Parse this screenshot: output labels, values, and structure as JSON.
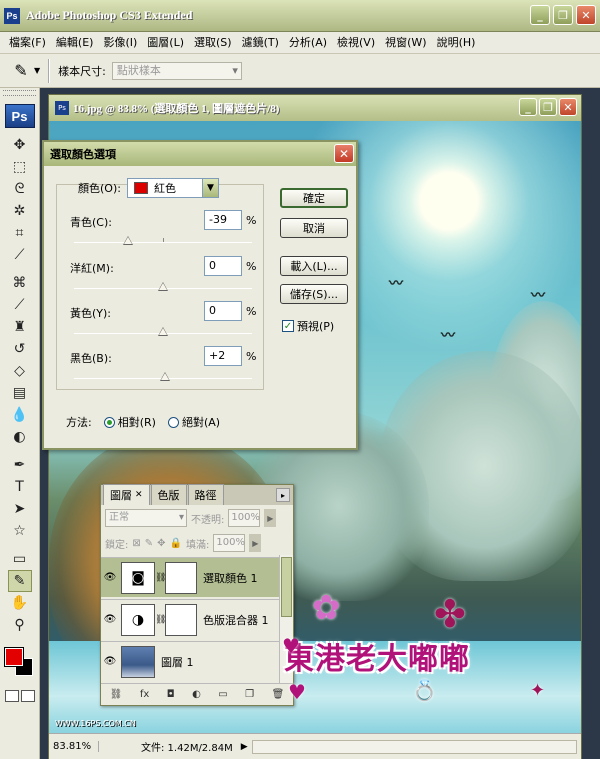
{
  "app": {
    "title": "Adobe Photoshop CS3 Extended",
    "logo": "Ps"
  },
  "menu": [
    "檔案(F)",
    "編輯(E)",
    "影像(I)",
    "圖層(L)",
    "選取(S)",
    "濾鏡(T)",
    "分析(A)",
    "檢視(V)",
    "視窗(W)",
    "說明(H)"
  ],
  "options": {
    "sample_label": "樣本尺寸:",
    "sample_value": "點狀樣本"
  },
  "document": {
    "title": "16.jpg @ 83.8% (選取顏色 1, 圖層遮色片/8)",
    "zoom": "83.81%",
    "info": "文件: 1.42M/2.84M",
    "watermark_url": "WWW.16PS.COM.CN"
  },
  "dialog": {
    "title": "選取顏色選項",
    "color_label": "顏色(O):",
    "color_value": "紅色",
    "color_swatch": "#dd0000",
    "sliders": [
      {
        "label": "青色(C):",
        "value": "-39",
        "pos": -39
      },
      {
        "label": "洋紅(M):",
        "value": "0",
        "pos": 0
      },
      {
        "label": "黃色(Y):",
        "value": "0",
        "pos": 0
      },
      {
        "label": "黑色(B):",
        "value": "+2",
        "pos": 2
      }
    ],
    "percent": "%",
    "method_label": "方法:",
    "method_relative": "相對(R)",
    "method_absolute": "絕對(A)",
    "buttons": {
      "ok": "確定",
      "cancel": "取消",
      "load": "載入(L)...",
      "save": "儲存(S)..."
    },
    "preview": "預視(P)"
  },
  "layers_panel": {
    "tabs": [
      "圖層",
      "色版",
      "路徑"
    ],
    "blend_mode": "正常",
    "opacity_label": "不透明:",
    "opacity_value": "100%",
    "lock_label": "鎖定:",
    "fill_label": "填滿:",
    "fill_value": "100%",
    "layers": [
      {
        "name": "選取顏色 1"
      },
      {
        "name": "色版混合器 1"
      },
      {
        "name": "圖層 1"
      }
    ]
  },
  "logo_watermark": {
    "text": "東港老大嘟嘟"
  },
  "colors": {
    "foreground": "#e30000",
    "background": "#000000",
    "title_bar": "#aeb884"
  }
}
